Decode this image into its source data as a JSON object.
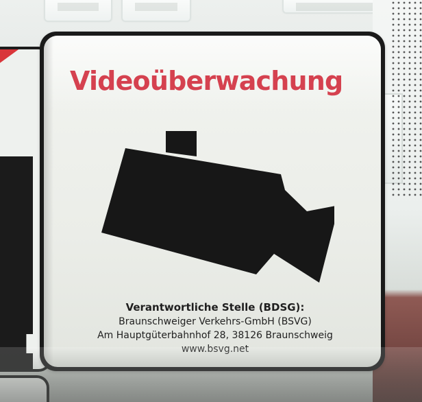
{
  "sign": {
    "headline": "Videoüberwachung",
    "responsible_label": "Verantwortliche Stelle (BDSG):",
    "organization": "Braunschweiger Verkehrs-GmbH (BSVG)",
    "address": "Am Hauptgüterbahnhof 28, 38126 Braunschweig",
    "website": "www.bsvg.net"
  },
  "icons": {
    "camera": "camera-icon"
  },
  "colors": {
    "headline": "#d5414f",
    "text": "#1f1f1f",
    "sign_border": "#1a1a1a",
    "sign_background": "#eceee9"
  }
}
